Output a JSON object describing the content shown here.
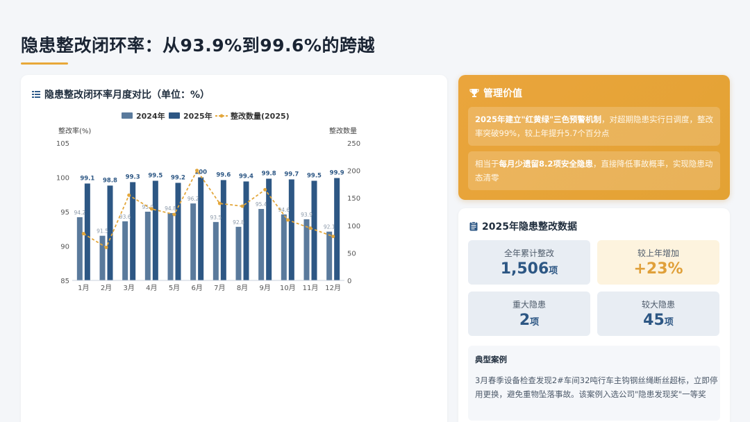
{
  "page": {
    "title": "隐患整改闭环率：从93.9%到99.6%的跨越"
  },
  "chart_panel": {
    "heading": "隐患整改闭环率月度对比（单位：%）"
  },
  "chart_data": {
    "type": "bar",
    "categories": [
      "1月",
      "2月",
      "3月",
      "4月",
      "5月",
      "6月",
      "7月",
      "8月",
      "9月",
      "10月",
      "11月",
      "12月"
    ],
    "series": [
      {
        "name": "2024年",
        "type": "bar",
        "axis": "left",
        "color": "#5a7a9c",
        "values": [
          94.2,
          91.5,
          93.6,
          95.0,
          94.8,
          96.2,
          93.5,
          92.8,
          95.4,
          94.6,
          93.9,
          92.1
        ],
        "labels": [
          "94.2",
          "91.5",
          "93.6",
          "95.0",
          "94.8",
          "96.2",
          "93.5",
          "92.8",
          "95.4",
          "94.6",
          "93.9",
          "92.1"
        ]
      },
      {
        "name": "2025年",
        "type": "bar",
        "axis": "right_of_pair",
        "color": "#2d5784",
        "values": [
          99.1,
          98.8,
          99.3,
          99.5,
          99.2,
          100,
          99.6,
          99.4,
          99.8,
          99.7,
          99.5,
          99.9
        ],
        "labels": [
          "99.1",
          "98.8",
          "99.3",
          "99.5",
          "99.2",
          "100",
          "99.6",
          "99.4",
          "99.8",
          "99.7",
          "99.5",
          "99.9"
        ]
      },
      {
        "name": "整改数量(2025)",
        "type": "line",
        "axis": "right",
        "color": "#e3a73c",
        "values": [
          85,
          60,
          155,
          130,
          120,
          200,
          140,
          135,
          165,
          110,
          95,
          80
        ]
      }
    ],
    "y_left": {
      "label": "整改率(%)",
      "min": 85,
      "max": 105,
      "ticks": [
        "85",
        "90",
        "95",
        "100",
        "105"
      ]
    },
    "y_right": {
      "label": "整改数量",
      "min": 0,
      "max": 250,
      "ticks": [
        "0",
        "50",
        "100",
        "150",
        "200",
        "250"
      ]
    },
    "legend_position": "top-center",
    "grid": false
  },
  "value_panel": {
    "title": "管理价值",
    "item1_bold": "2025年建立\"红黄绿\"三色预警机制",
    "item1_rest": "，对超期隐患实行日调度，整改率突破99%，较上年提升5.7个百分点",
    "item2_pre": "相当于",
    "item2_bold": "每月少遗留8.2项安全隐患",
    "item2_rest": "，直接降低事故概率，实现隐患动态清零"
  },
  "data_panel": {
    "title": "2025年隐患整改数据",
    "stats": [
      {
        "label": "全年累计整改",
        "value": "1,506",
        "unit": "项"
      },
      {
        "label": "较上年增加",
        "value": "+23%",
        "unit": ""
      },
      {
        "label": "重大隐患",
        "value": "2",
        "unit": "项"
      },
      {
        "label": "较大隐患",
        "value": "45",
        "unit": "项"
      }
    ],
    "case_title": "典型案例",
    "case_text": "3月春季设备检查发现2#车间32吨行车主钩钢丝绳断丝超标，立即停用更换，避免重物坠落事故。该案例入选公司\"隐患发现奖\"一等奖"
  },
  "colors": {
    "accent": "#e8a838",
    "bar_2024": "#5a7a9c",
    "bar_2025": "#2d5784",
    "line_2025": "#e3a73c"
  }
}
